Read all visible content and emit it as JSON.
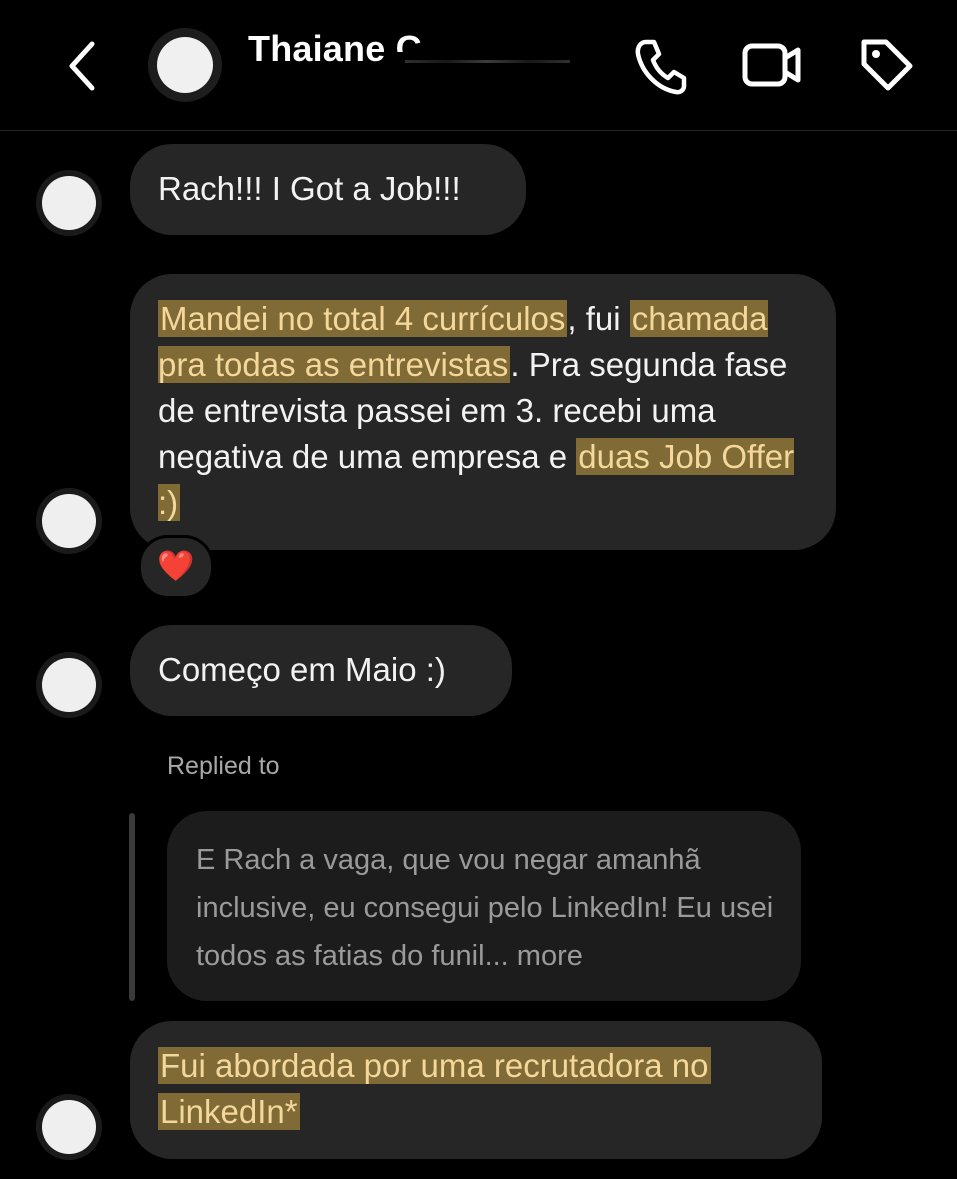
{
  "header": {
    "title": "Thaiane C",
    "back_icon": "chevron-left-icon",
    "call_icon": "phone-icon",
    "video_icon": "video-camera-icon",
    "tag_icon": "tag-icon"
  },
  "messages": [
    {
      "text": "Rach!!! I Got a Job!!!"
    },
    {
      "p1": "Mandei no total 4 currículos",
      "p2": ", fui ",
      "p3": "chamada pra todas as entrevistas",
      "p4": ". Pra segunda fase de entrevista passei em 3. recebi uma negativa de uma empresa e ",
      "p5": "duas Job Offer :)"
    },
    {
      "text": "Começo em Maio :)"
    },
    {
      "line1": "Fui abordada por uma recrutadora no",
      "line2": "LinkedIn*"
    }
  ],
  "reaction": {
    "emoji": "❤️"
  },
  "reply": {
    "label": "Replied to ",
    "text": "E Rach a vaga, que vou negar amanhã inclusive, eu consegui pelo LinkedIn! Eu usei todos as fatias do funil... more"
  },
  "colors": {
    "background": "#000000",
    "bubble": "#262626",
    "highlight": "#806a36",
    "highlight_text": "#f4d79b"
  }
}
